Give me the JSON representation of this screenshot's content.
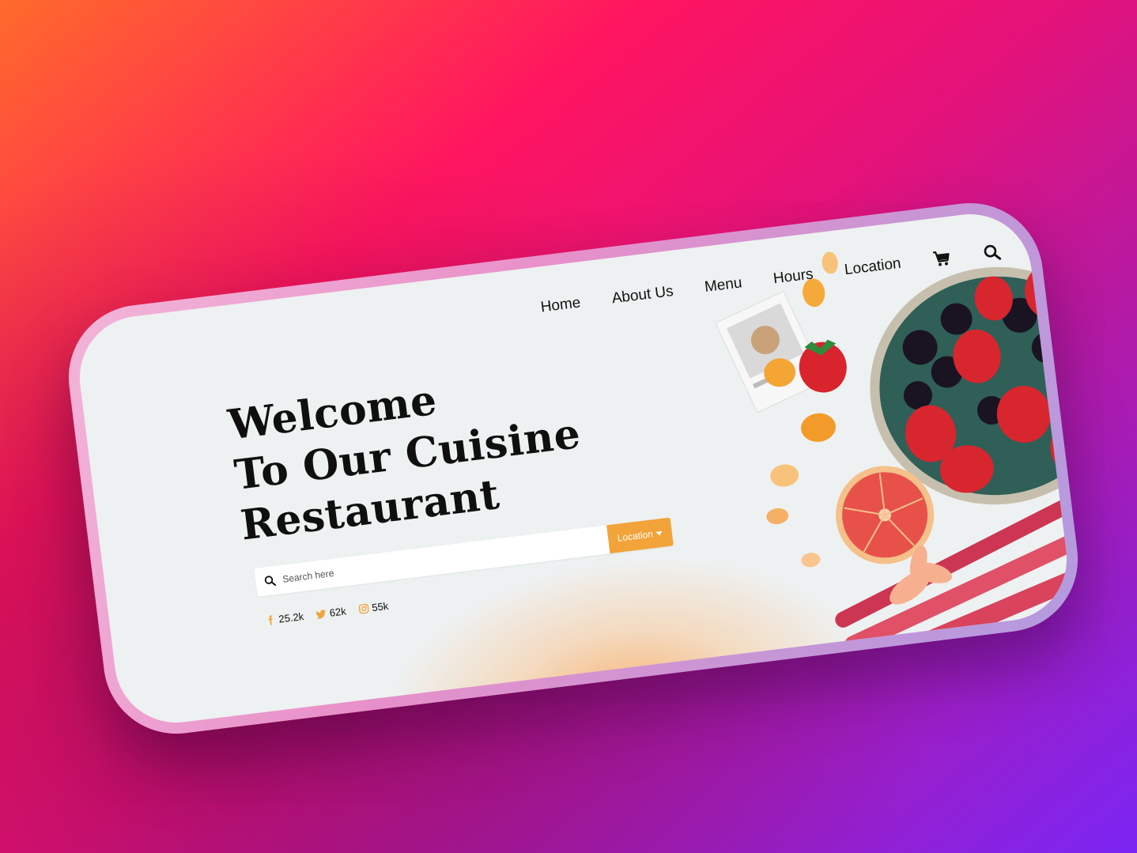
{
  "nav": {
    "items": [
      {
        "label": "Home"
      },
      {
        "label": "About Us"
      },
      {
        "label": "Menu"
      },
      {
        "label": "Hours"
      },
      {
        "label": "Location"
      }
    ],
    "icons": [
      "cart-icon",
      "search-icon"
    ]
  },
  "hero": {
    "lines": [
      "Welcome",
      "To Our Cuisine",
      "Restaurant"
    ]
  },
  "search": {
    "placeholder": "Search here",
    "location_label": "Location"
  },
  "social": {
    "facebook": "25.2k",
    "twitter": "62k",
    "instagram": "55k"
  },
  "colors": {
    "accent": "#f2a33a",
    "text": "#111111",
    "screen_bg": "#eef1f1",
    "frame": "#e890c9"
  }
}
